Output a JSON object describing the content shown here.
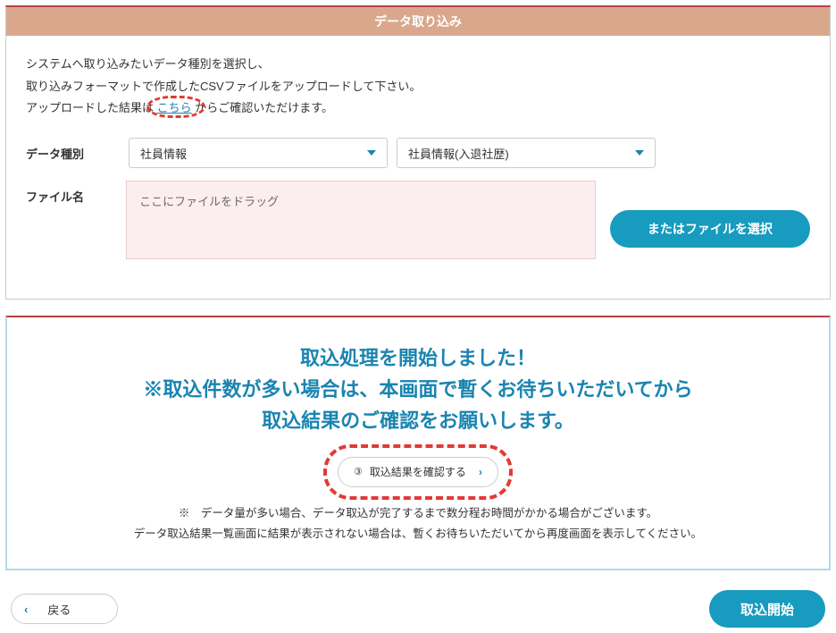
{
  "panel1": {
    "title": "データ取り込み",
    "instructions": {
      "line1": "システムへ取り込みたいデータ種別を選択し、",
      "line2": "取り込みフォーマットで作成したCSVファイルをアップロードして下さい。",
      "line3_prefix": "アップロードした結果は",
      "link": "こちら",
      "line3_suffix": "からご確認いただけます。"
    },
    "form": {
      "data_type_label": "データ種別",
      "select1_value": "社員情報",
      "select2_value": "社員情報(入退社歴)",
      "filename_label": "ファイル名",
      "dropzone_text": "ここにファイルをドラッグ",
      "file_button": "またはファイルを選択"
    }
  },
  "panel2": {
    "heading_line1": "取込処理を開始しました！",
    "heading_line2": "※取込件数が多い場合は、本画面で暫くお待ちいただいてから",
    "heading_line3": "取込結果のご確認をお願いします。",
    "confirm_step_num": "③",
    "confirm_button": "取込結果を確認する",
    "note_line1": "※　データ量が多い場合、データ取込が完了するまで数分程お時間がかかる場合がございます。",
    "note_line2": "データ取込結果一覧画面に結果が表示されない場合は、暫くお待ちいただいてから再度画面を表示してください。"
  },
  "footer": {
    "back": "戻る",
    "start": "取込開始"
  }
}
